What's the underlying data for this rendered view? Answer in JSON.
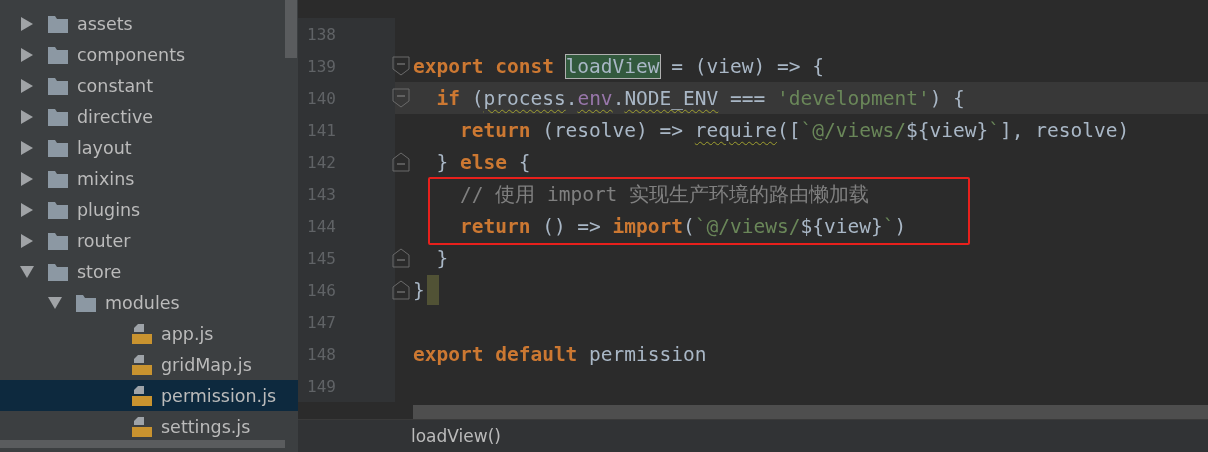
{
  "project_tree": {
    "items": [
      {
        "name": "assets",
        "kind": "folder",
        "expanded": false,
        "selected": false
      },
      {
        "name": "components",
        "kind": "folder",
        "expanded": false,
        "selected": false
      },
      {
        "name": "constant",
        "kind": "folder",
        "expanded": false,
        "selected": false
      },
      {
        "name": "directive",
        "kind": "folder",
        "expanded": false,
        "selected": false
      },
      {
        "name": "layout",
        "kind": "folder",
        "expanded": false,
        "selected": false
      },
      {
        "name": "mixins",
        "kind": "folder",
        "expanded": false,
        "selected": false
      },
      {
        "name": "plugins",
        "kind": "folder",
        "expanded": false,
        "selected": false
      },
      {
        "name": "router",
        "kind": "folder",
        "expanded": false,
        "selected": false
      },
      {
        "name": "store",
        "kind": "folder",
        "expanded": true,
        "selected": false,
        "children": [
          {
            "name": "modules",
            "kind": "folder",
            "expanded": true,
            "selected": false,
            "children": [
              {
                "name": "app.js",
                "kind": "file",
                "selected": false
              },
              {
                "name": "gridMap.js",
                "kind": "file",
                "selected": false
              },
              {
                "name": "permission.js",
                "kind": "file",
                "selected": true
              },
              {
                "name": "settings.js",
                "kind": "file",
                "selected": false
              }
            ]
          }
        ]
      }
    ]
  },
  "editor": {
    "lines": [
      {
        "number": "138",
        "kind": "plain",
        "current": false
      },
      {
        "number": "139",
        "kind": "opener",
        "current": false,
        "tokens": [
          {
            "text": "export const ",
            "kind": "keyword"
          },
          {
            "text": "loadView",
            "kind": "match"
          },
          {
            "text": " = (view) => {",
            "kind": "plain"
          }
        ]
      },
      {
        "number": "140",
        "kind": "opener",
        "current": true,
        "tokens": [
          {
            "text": "  if ",
            "kind": "keyword"
          },
          {
            "text": "(",
            "kind": "plain"
          },
          {
            "text": "process",
            "kind": "warning"
          },
          {
            "text": ".",
            "kind": "plain"
          },
          {
            "text": "env",
            "kind": "property"
          },
          {
            "text": ".",
            "kind": "plain"
          },
          {
            "text": "NODE_ENV",
            "kind": "warning"
          },
          {
            "text": " === ",
            "kind": "plain"
          },
          {
            "text": "'development'",
            "kind": "string"
          },
          {
            "text": ") {",
            "kind": "plain"
          }
        ]
      },
      {
        "number": "141",
        "kind": "plain",
        "current": false,
        "tokens": [
          {
            "text": "    return ",
            "kind": "keyword"
          },
          {
            "text": "(resolve) => ",
            "kind": "plain"
          },
          {
            "text": "require",
            "kind": "warning"
          },
          {
            "text": "([",
            "kind": "plain"
          },
          {
            "text": "`@/views/",
            "kind": "string"
          },
          {
            "text": "${view}",
            "kind": "plain"
          },
          {
            "text": "`",
            "kind": "string"
          },
          {
            "text": "], resolve)",
            "kind": "plain"
          }
        ]
      },
      {
        "number": "142",
        "kind": "closer",
        "current": false,
        "tokens": [
          {
            "text": "  } ",
            "kind": "plain"
          },
          {
            "text": "else ",
            "kind": "keyword"
          },
          {
            "text": "{",
            "kind": "plain"
          }
        ]
      },
      {
        "number": "143",
        "kind": "plain",
        "current": false,
        "tokens": [
          {
            "text": "    // 使用 import 实现生产环境的路由懒加载",
            "kind": "comment"
          }
        ]
      },
      {
        "number": "144",
        "kind": "plain",
        "current": false,
        "tokens": [
          {
            "text": "    return ",
            "kind": "keyword"
          },
          {
            "text": "() => ",
            "kind": "plain"
          },
          {
            "text": "import",
            "kind": "keyword"
          },
          {
            "text": "(",
            "kind": "plain"
          },
          {
            "text": "`@/views/",
            "kind": "string"
          },
          {
            "text": "${view}",
            "kind": "plain"
          },
          {
            "text": "`",
            "kind": "string"
          },
          {
            "text": ")",
            "kind": "plain"
          }
        ]
      },
      {
        "number": "145",
        "kind": "closer",
        "current": false,
        "tokens": [
          {
            "text": "  }",
            "kind": "plain"
          }
        ]
      },
      {
        "number": "146",
        "kind": "closer",
        "current": false,
        "caret": true,
        "tokens": [
          {
            "text": "}",
            "kind": "plain"
          }
        ]
      },
      {
        "number": "147",
        "kind": "plain",
        "current": false
      },
      {
        "number": "148",
        "kind": "plain",
        "current": false,
        "tokens": [
          {
            "text": "export default ",
            "kind": "keyword"
          },
          {
            "text": "permission",
            "kind": "plain"
          }
        ]
      },
      {
        "number": "149",
        "kind": "plain",
        "current": false
      }
    ]
  },
  "status_bar": {
    "breadcrumb": "loadView()"
  }
}
